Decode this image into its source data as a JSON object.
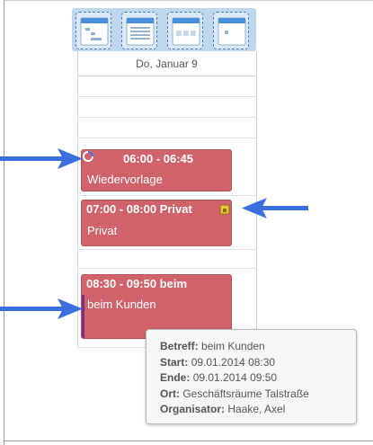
{
  "colors": {
    "event_fill": "#d0626c",
    "arrow": "#3b6fe0",
    "toolbar": "#bfd6ef",
    "category_marker": "#7b2f87"
  },
  "toolbar": {
    "buttons": [
      {
        "name": "day-view",
        "icon": "day-calendar-icon"
      },
      {
        "name": "list-view",
        "icon": "list-view-icon"
      },
      {
        "name": "three-day-view",
        "icon": "three-column-calendar-icon"
      },
      {
        "name": "week-view",
        "icon": "week-calendar-icon"
      }
    ]
  },
  "calendar": {
    "day_label": "Do, Januar 9",
    "events": [
      {
        "time": "06:00 - 06:45",
        "subject": "Wiedervorlage",
        "icon": "recurrence-icon"
      },
      {
        "time": "07:00 - 08:00 Privat",
        "subject": "Privat",
        "icon": "private-lock-icon"
      },
      {
        "time": "08:30 - 09:50 beim",
        "subject": "beim Kunden",
        "icon": "category-marker"
      }
    ]
  },
  "tooltip": {
    "rows": [
      {
        "label": "Betreff:",
        "value": "beim Kunden"
      },
      {
        "label": "Start:",
        "value": "09.01.2014 08:30"
      },
      {
        "label": "Ende:",
        "value": "09.01.2014 09:50"
      },
      {
        "label": "Ort:",
        "value": "Geschäftsräume Talstraße"
      },
      {
        "label": "Organisator:",
        "value": "Haake, Axel"
      }
    ]
  }
}
